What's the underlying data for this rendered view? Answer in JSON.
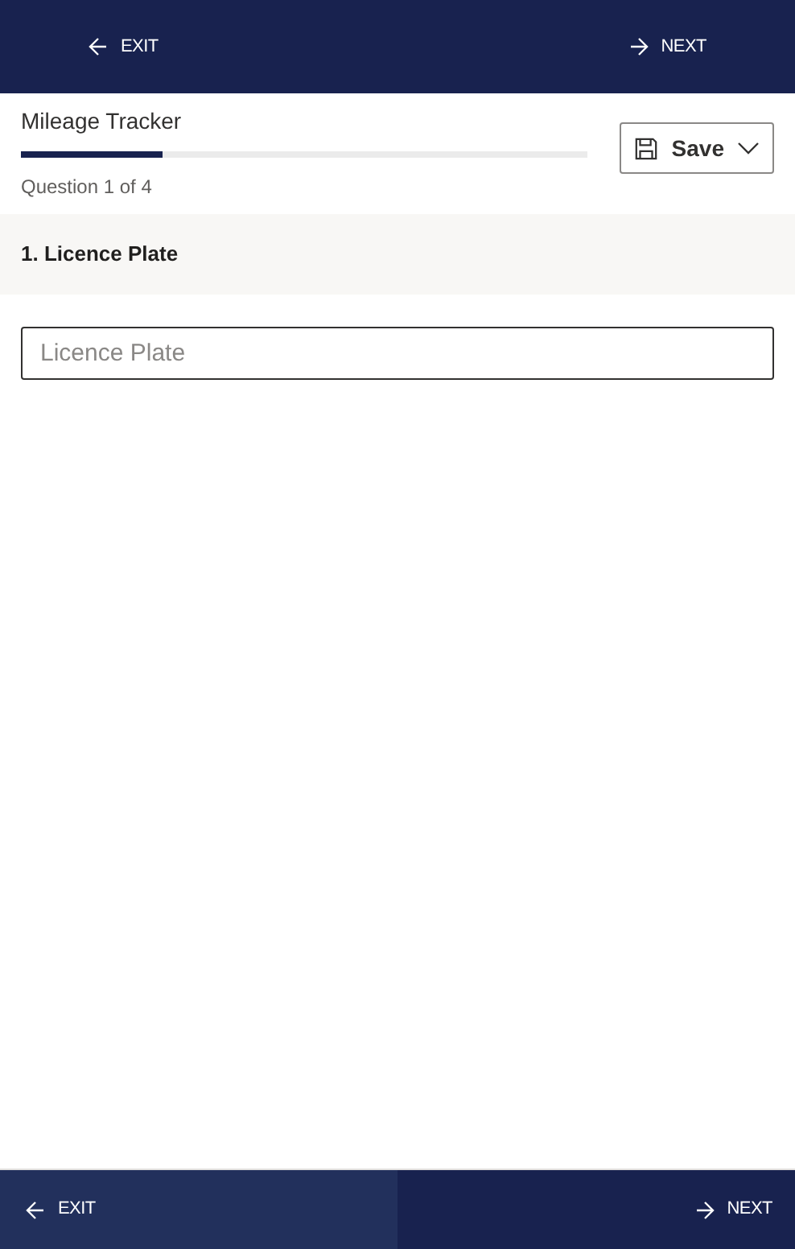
{
  "top_bar": {
    "exit": {
      "label": "EXIT"
    },
    "next": {
      "label": "NEXT"
    }
  },
  "header": {
    "title": "Mileage Tracker",
    "progress": {
      "level": 0.25
    },
    "counter": "Question 1 of 4",
    "save_button": {
      "label": "Save"
    }
  },
  "question": {
    "heading": "1. Licence Plate",
    "field": {
      "placeholder": "Licence Plate"
    }
  },
  "bottom_bar": {
    "exit": {
      "label": "EXIT",
      "highlighted": true
    },
    "next": {
      "label": "NEXT",
      "highlighted": false
    }
  }
}
